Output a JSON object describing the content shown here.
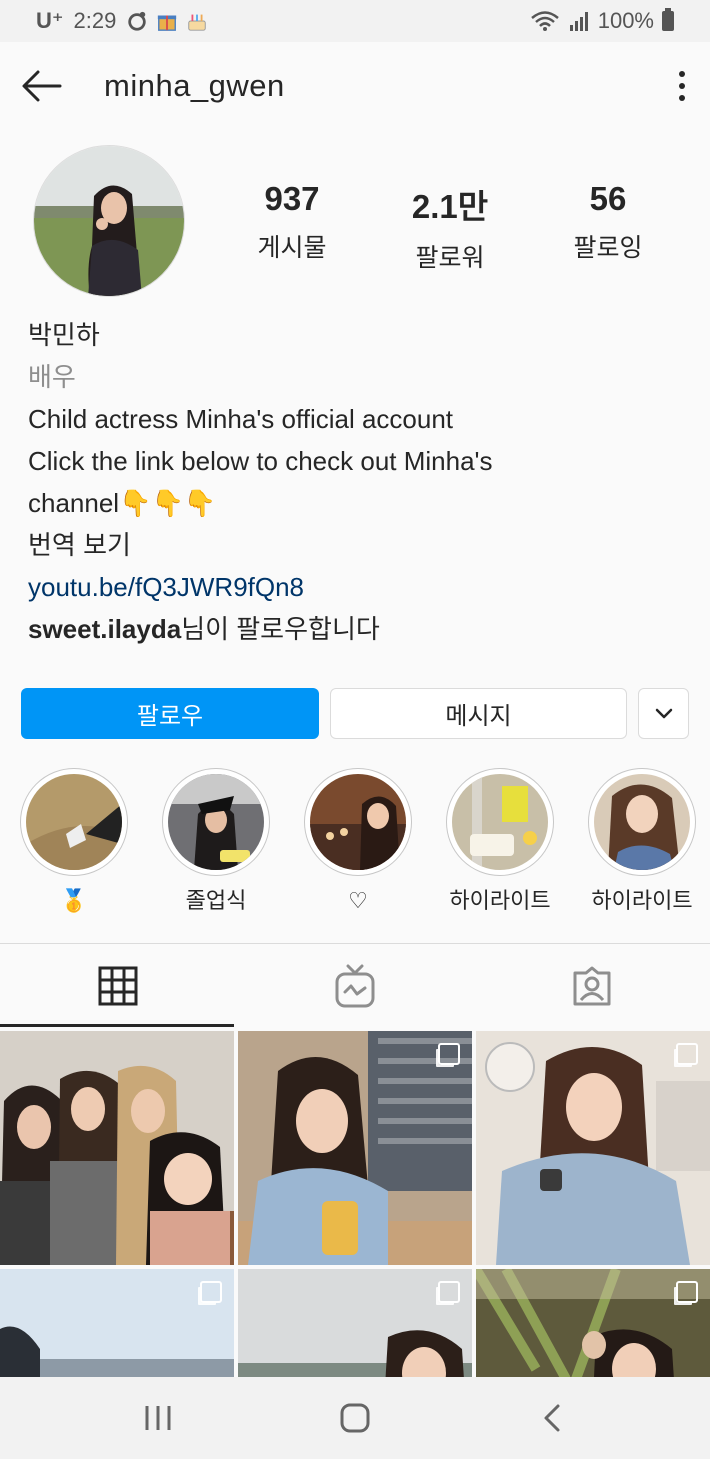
{
  "status_bar": {
    "carrier": "U⁺",
    "time": "2:29",
    "battery_pct": "100%",
    "notification_icons": [
      "record-icon",
      "gift-icon",
      "cake-icon"
    ]
  },
  "header": {
    "username": "minha_gwen"
  },
  "stats": {
    "posts": {
      "value": "937",
      "label": "게시물"
    },
    "followers": {
      "value": "2.1만",
      "label": "팔로워"
    },
    "following": {
      "value": "56",
      "label": "팔로잉"
    }
  },
  "bio": {
    "name": "박민하",
    "category": "배우",
    "line1": "Child actress Minha's official account",
    "line2": "Click the link below to check out Minha's",
    "line3": "channel👇👇👇",
    "translate": "번역 보기",
    "link": "youtu.be/fQ3JWR9fQn8",
    "followed_by_user": "sweet.ilayda",
    "followed_by_suffix": "님이 팔로우합니다"
  },
  "actions": {
    "follow": "팔로우",
    "message": "메시지"
  },
  "highlights": [
    {
      "label": "🥇"
    },
    {
      "label": "졸업식"
    },
    {
      "label": "♡"
    },
    {
      "label": "하이라이트"
    },
    {
      "label": "하이라이트"
    }
  ],
  "tabs": [
    "grid-icon",
    "igtv-icon",
    "tagged-icon"
  ],
  "colors": {
    "accent": "#0095f6",
    "link": "#003569",
    "secondary_text": "#8e8e8e"
  }
}
